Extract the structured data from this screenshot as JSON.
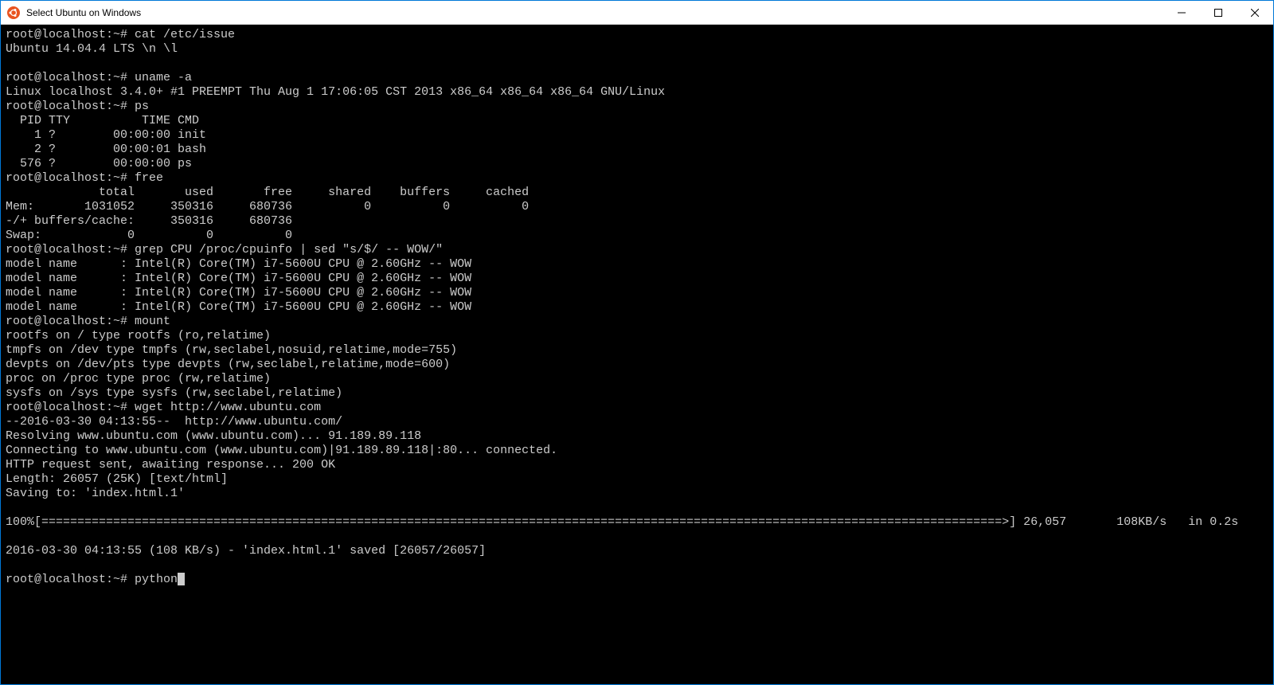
{
  "window": {
    "title": "Select Ubuntu on Windows"
  },
  "prompt": "root@localhost:~# ",
  "lines": {
    "l1_cmd": "cat /etc/issue",
    "l2": "Ubuntu 14.04.4 LTS \\n \\l",
    "l3": "",
    "l4_cmd": "uname -a",
    "l5": "Linux localhost 3.4.0+ #1 PREEMPT Thu Aug 1 17:06:05 CST 2013 x86_64 x86_64 x86_64 GNU/Linux",
    "l6_cmd": "ps",
    "l7": "  PID TTY          TIME CMD",
    "l8": "    1 ?        00:00:00 init",
    "l9": "    2 ?        00:00:01 bash",
    "l10": "  576 ?        00:00:00 ps",
    "l11_cmd": "free",
    "l12": "             total       used       free     shared    buffers     cached",
    "l13": "Mem:       1031052     350316     680736          0          0          0",
    "l14": "-/+ buffers/cache:     350316     680736",
    "l15": "Swap:            0          0          0",
    "l16_cmd": "grep CPU /proc/cpuinfo | sed \"s/$/ -- WOW/\"",
    "l17": "model name      : Intel(R) Core(TM) i7-5600U CPU @ 2.60GHz -- WOW",
    "l18": "model name      : Intel(R) Core(TM) i7-5600U CPU @ 2.60GHz -- WOW",
    "l19": "model name      : Intel(R) Core(TM) i7-5600U CPU @ 2.60GHz -- WOW",
    "l20": "model name      : Intel(R) Core(TM) i7-5600U CPU @ 2.60GHz -- WOW",
    "l21_cmd": "mount",
    "l22": "rootfs on / type rootfs (ro,relatime)",
    "l23": "tmpfs on /dev type tmpfs (rw,seclabel,nosuid,relatime,mode=755)",
    "l24": "devpts on /dev/pts type devpts (rw,seclabel,relatime,mode=600)",
    "l25": "proc on /proc type proc (rw,relatime)",
    "l26": "sysfs on /sys type sysfs (rw,seclabel,relatime)",
    "l27_cmd": "wget http://www.ubuntu.com",
    "l28": "--2016-03-30 04:13:55--  http://www.ubuntu.com/",
    "l29": "Resolving www.ubuntu.com (www.ubuntu.com)... 91.189.89.118",
    "l30": "Connecting to www.ubuntu.com (www.ubuntu.com)|91.189.89.118|:80... connected.",
    "l31": "HTTP request sent, awaiting response... 200 OK",
    "l32": "Length: 26057 (25K) [text/html]",
    "l33": "Saving to: 'index.html.1'",
    "l34": "",
    "l35": "100%[======================================================================================================================================>] 26,057       108KB/s   in 0.2s",
    "l36": "",
    "l37": "2016-03-30 04:13:55 (108 KB/s) - 'index.html.1' saved [26057/26057]",
    "l38": "",
    "l39_cmd": "python"
  }
}
